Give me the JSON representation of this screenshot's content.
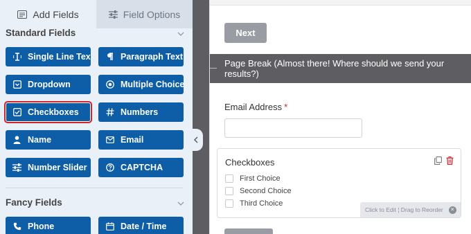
{
  "tabs": {
    "add_fields": "Add Fields",
    "field_options": "Field Options"
  },
  "sections": {
    "standard": "Standard Fields",
    "fancy": "Fancy Fields"
  },
  "standard_fields": [
    {
      "label": "Single Line Text",
      "icon": "text-cursor-icon"
    },
    {
      "label": "Paragraph Text",
      "icon": "paragraph-icon"
    },
    {
      "label": "Dropdown",
      "icon": "dropdown-icon"
    },
    {
      "label": "Multiple Choice",
      "icon": "radio-icon"
    },
    {
      "label": "Checkboxes",
      "icon": "checkbox-icon",
      "selected": true
    },
    {
      "label": "Numbers",
      "icon": "hash-icon"
    },
    {
      "label": "Name",
      "icon": "person-icon"
    },
    {
      "label": "Email",
      "icon": "envelope-icon"
    },
    {
      "label": "Number Slider",
      "icon": "sliders-icon"
    },
    {
      "label": "CAPTCHA",
      "icon": "question-circle-icon"
    }
  ],
  "fancy_fields": [
    {
      "label": "Phone",
      "icon": "phone-icon"
    },
    {
      "label": "Date / Time",
      "icon": "calendar-icon"
    }
  ],
  "preview": {
    "next_label": "Next",
    "page_break": "Page Break (Almost there! Where should we send your results?)",
    "email_label": "Email Address",
    "required_mark": "*",
    "checkboxes_title": "Checkboxes",
    "choices": [
      "First Choice",
      "Second Choice",
      "Third Choice"
    ],
    "hint": "Click to Edit ¦ Drag to Reorder"
  },
  "colors": {
    "button_blue": "#0d5ea6",
    "selected_outline": "#d52128",
    "panel_bg": "#eaf0f8",
    "dark_strip": "#5e5e62",
    "delete_red": "#d52128"
  }
}
